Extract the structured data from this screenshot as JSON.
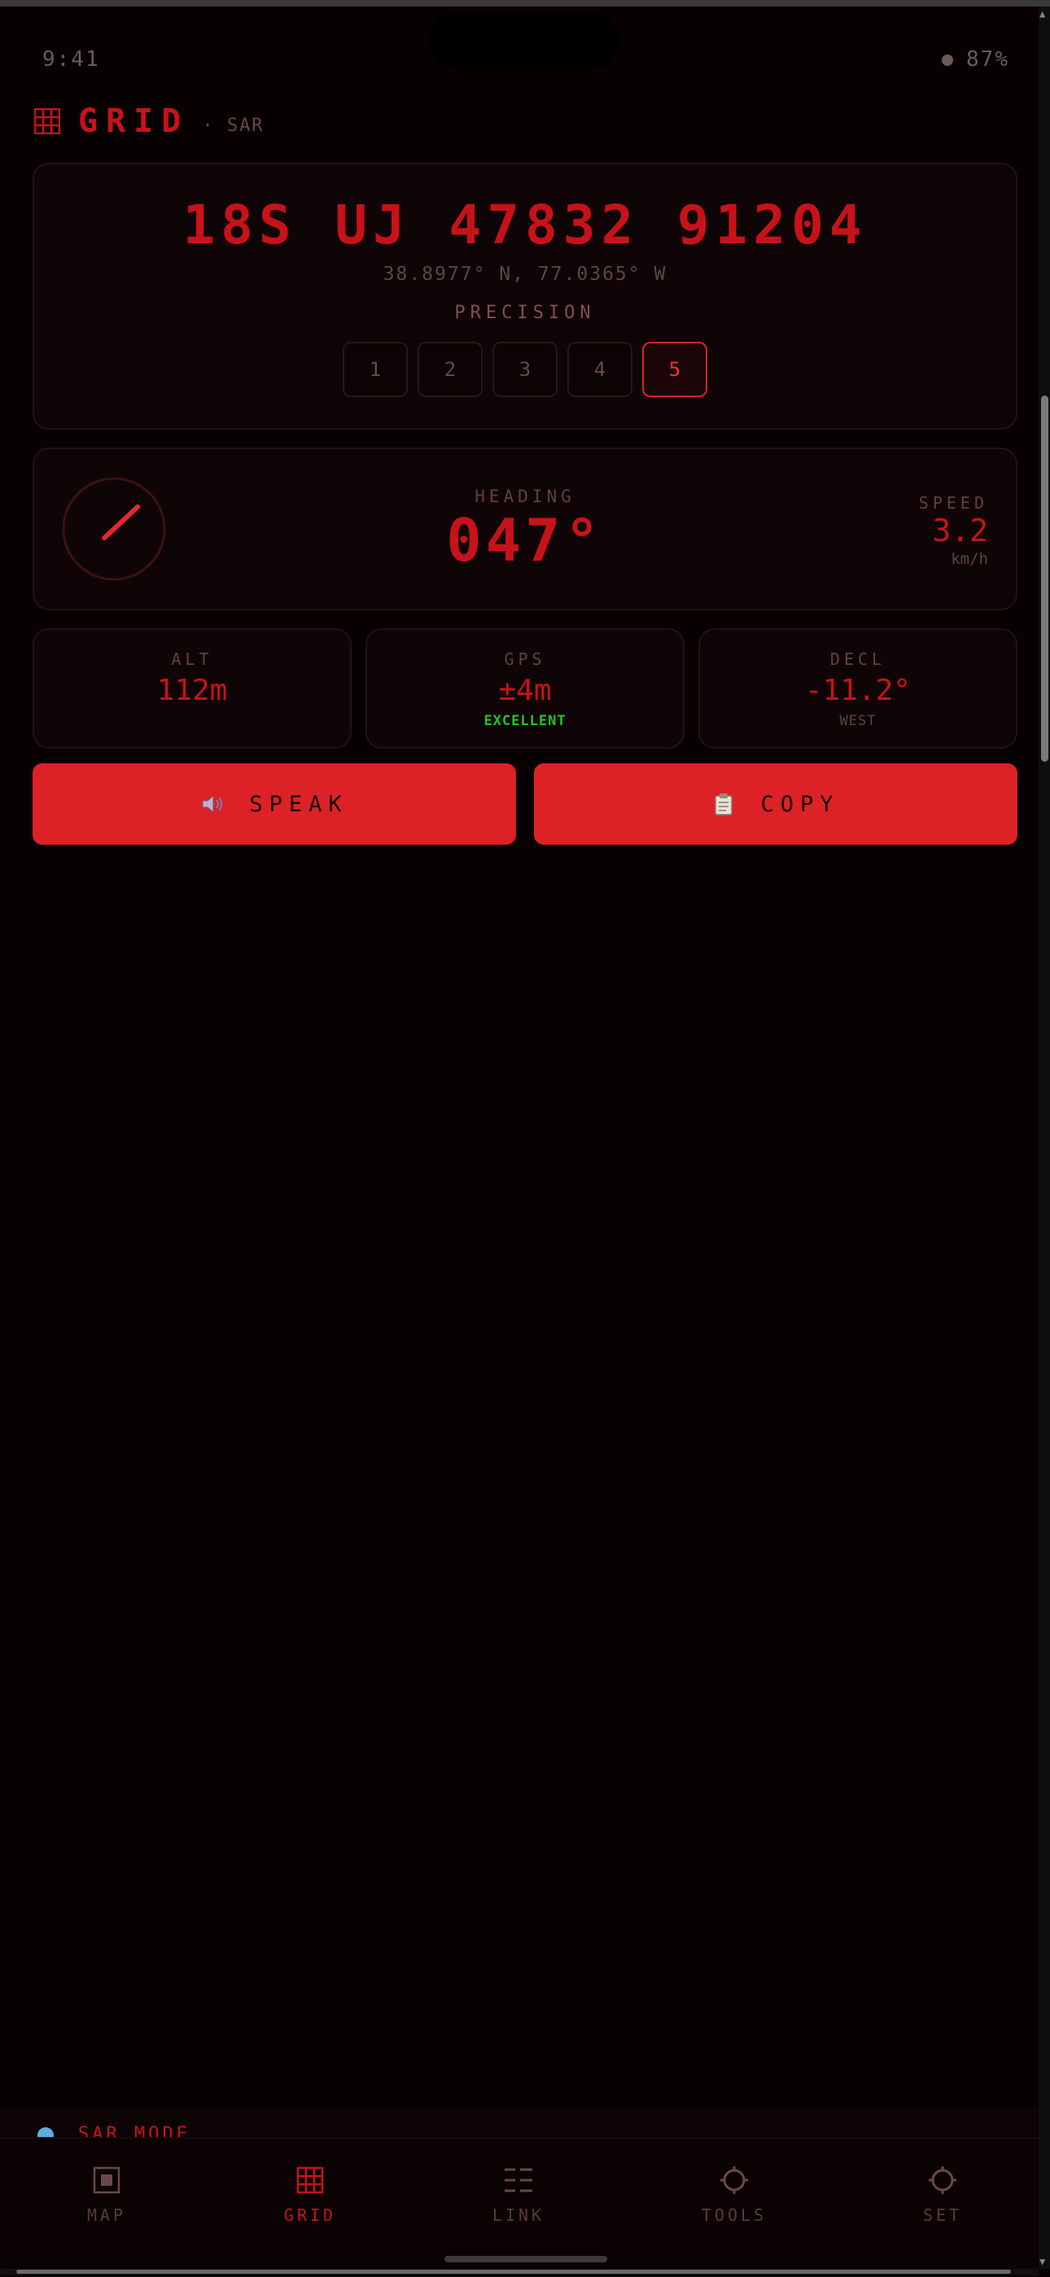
{
  "status": {
    "time": "9:41",
    "battery": "87%"
  },
  "app": {
    "title": "GRID",
    "subtitle": "· SAR"
  },
  "coordinate": {
    "mgrs": "18S UJ 47832 91204",
    "latlon": "38.8977° N, 77.0365° W",
    "precision_label": "PRECISION",
    "precision_options": [
      "1",
      "2",
      "3",
      "4",
      "5"
    ],
    "precision_selected": "5"
  },
  "heading": {
    "label": "HEADING",
    "value": "047°",
    "degrees": 47,
    "speed_label": "SPEED",
    "speed_value": "3.2",
    "speed_unit": "km/h"
  },
  "stats": {
    "alt": {
      "label": "ALT",
      "value": "112m"
    },
    "gps": {
      "label": "GPS",
      "value": "±4m",
      "sub": "EXCELLENT"
    },
    "decl": {
      "label": "DECL",
      "value": "-11.2°",
      "sub": "WEST"
    }
  },
  "actions": {
    "speak": "SPEAK",
    "copy": "COPY"
  },
  "mode_banner": {
    "text": "SAR MODE"
  },
  "nav": {
    "items": [
      {
        "label": "MAP",
        "icon": "map-icon"
      },
      {
        "label": "GRID",
        "icon": "grid-icon"
      },
      {
        "label": "LINK",
        "icon": "list-icon"
      },
      {
        "label": "TOOLS",
        "icon": "gear-icon"
      },
      {
        "label": "SET",
        "icon": "gear-icon"
      }
    ],
    "active": "GRID"
  },
  "colors": {
    "accent": "#c8121a",
    "button": "#dc2226",
    "good": "#23c22a",
    "background": "#080102"
  }
}
